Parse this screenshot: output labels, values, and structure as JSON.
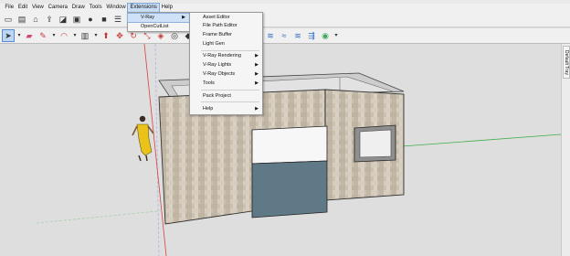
{
  "menubar": {
    "items": [
      {
        "label": "File",
        "active": false
      },
      {
        "label": "Edit",
        "active": false
      },
      {
        "label": "View",
        "active": false
      },
      {
        "label": "Camera",
        "active": false
      },
      {
        "label": "Draw",
        "active": false
      },
      {
        "label": "Tools",
        "active": false
      },
      {
        "label": "Window",
        "active": false
      },
      {
        "label": "Extensions",
        "active": true
      },
      {
        "label": "Help",
        "active": false
      }
    ]
  },
  "extensions_menu": {
    "items": [
      {
        "label": "V-Ray",
        "submenu": true,
        "highlighted": true
      },
      {
        "label": "OpenCutList",
        "submenu": false,
        "highlighted": false
      }
    ]
  },
  "vray_submenu": {
    "items": [
      {
        "label": "Asset Editor",
        "submenu": false
      },
      {
        "label": "File Path Editor",
        "submenu": false
      },
      {
        "label": "Frame Buffer",
        "submenu": false
      },
      {
        "label": "Light Gen",
        "submenu": false
      },
      {
        "label": "V-Ray Rendering",
        "submenu": true
      },
      {
        "label": "V-Ray Lights",
        "submenu": true
      },
      {
        "label": "V-Ray Objects",
        "submenu": true
      },
      {
        "label": "Tools",
        "submenu": true
      },
      {
        "label": "Pack Project",
        "submenu": false
      },
      {
        "label": "Help",
        "submenu": true
      }
    ]
  },
  "toolbar_row1": {
    "icons": [
      "new-file-icon",
      "open-file-icon",
      "warehouse-icon",
      "share-model-icon",
      "extension-warehouse-icon",
      "components-icon",
      "materials-icon",
      "styles-icon",
      "layers-icon",
      "scenes-icon",
      "print-icon"
    ]
  },
  "toolbar_row2": {
    "icons": [
      "select-arrow-icon",
      "eraser-icon",
      "line-pencil-icon",
      "arc-icon",
      "rectangle-icon",
      "push-pull-icon",
      "move-icon",
      "rotate-icon",
      "scale-icon",
      "offset-icon",
      "tape-measure-icon",
      "paint-bucket-icon",
      "orbit-icon",
      "pan-icon",
      "zoom-icon",
      "zoom-extents-icon",
      "vray-render-icon",
      "vray-interactive-icon",
      "vray-frame-buffer-icon",
      "vray-asset-editor-icon",
      "vray-lights-icon",
      "vray-sun-icon",
      "profile-icon"
    ]
  },
  "right_tray": {
    "tab_label": "Default Tray"
  },
  "colors": {
    "menu_highlight": "#c9def5",
    "wall_stone": "#c9bfae",
    "door_glass": "#5f7a86",
    "axis_green": "#3fae4a",
    "axis_red": "#d64040",
    "axis_blue": "#3c6fd1",
    "figure_yellow": "#e9c21a"
  }
}
